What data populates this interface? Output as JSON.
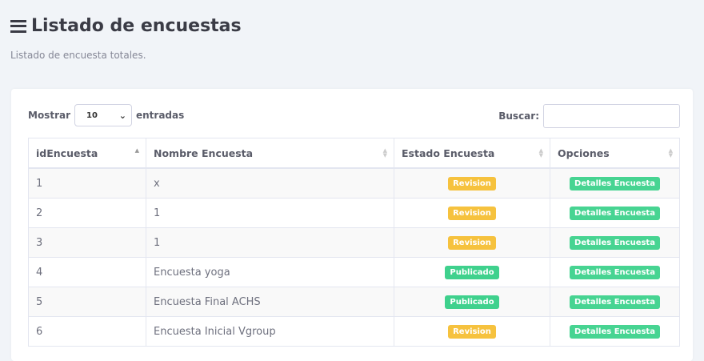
{
  "header": {
    "title": "Listado de encuestas",
    "subtitle": "Listado de encuesta totales."
  },
  "controls": {
    "show_label": "Mostrar",
    "page_size": "10",
    "entries_label": "entradas",
    "search_label": "Buscar:",
    "search_value": ""
  },
  "columns": [
    "idEncuesta",
    "Nombre Encuesta",
    "Estado Encuesta",
    "Opciones"
  ],
  "rows": [
    {
      "id": "1",
      "name": "x",
      "status": "Revision",
      "action": "Detalles Encuesta"
    },
    {
      "id": "2",
      "name": "1",
      "status": "Revision",
      "action": "Detalles Encuesta"
    },
    {
      "id": "3",
      "name": "1",
      "status": "Revision",
      "action": "Detalles Encuesta"
    },
    {
      "id": "4",
      "name": "Encuesta yoga",
      "status": "Publicado",
      "action": "Detalles Encuesta"
    },
    {
      "id": "5",
      "name": "Encuesta Final ACHS",
      "status": "Publicado",
      "action": "Detalles Encuesta"
    },
    {
      "id": "6",
      "name": "Encuesta Inicial Vgroup",
      "status": "Revision",
      "action": "Detalles Encuesta"
    }
  ],
  "colors": {
    "revision": "#f6c23e",
    "publicado": "#3fd18d",
    "detalles": "#47d492"
  }
}
